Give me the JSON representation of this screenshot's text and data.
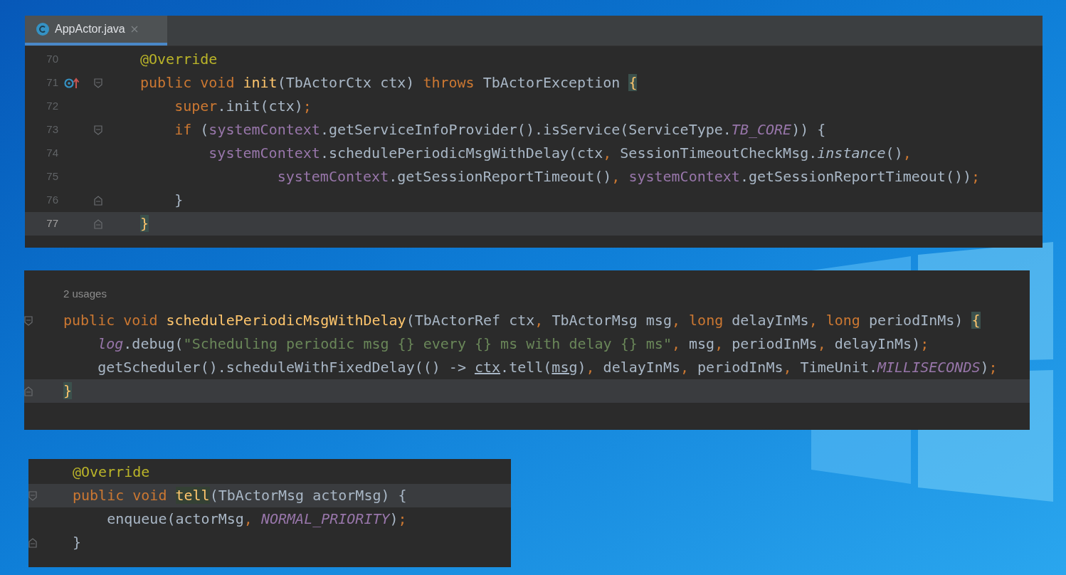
{
  "panels": [
    {
      "tab": {
        "label": "AppActor.java",
        "selected": true
      },
      "lines": [
        {
          "number": "70",
          "current": false,
          "tokens": [
            {
              "text": "@Override",
              "kind": "anno"
            }
          ]
        },
        {
          "number": "71",
          "current": false,
          "override_marker": true,
          "fold_start": true,
          "tokens": [
            {
              "text": "public void ",
              "kind": "kw"
            },
            {
              "text": "init",
              "kind": "decl"
            },
            {
              "text": "(TbActorCtx ctx) ",
              "kind": "plain"
            },
            {
              "text": "throws ",
              "kind": "kw"
            },
            {
              "text": "TbActorException ",
              "kind": "plain"
            },
            {
              "text": "{",
              "kind": "brace"
            }
          ]
        },
        {
          "number": "72",
          "current": false,
          "tokens": [
            {
              "text": "    super",
              "kind": "kw"
            },
            {
              "text": ".init(ctx)",
              "kind": "plain"
            },
            {
              "text": ";",
              "kind": "punct"
            }
          ]
        },
        {
          "number": "73",
          "current": false,
          "fold_start": true,
          "tokens": [
            {
              "text": "    if ",
              "kind": "kw"
            },
            {
              "text": "(",
              "kind": "plain"
            },
            {
              "text": "systemContext",
              "kind": "field"
            },
            {
              "text": ".getServiceInfoProvider().isService(ServiceType.",
              "kind": "plain"
            },
            {
              "text": "TB_CORE",
              "kind": "static"
            },
            {
              "text": ")) {",
              "kind": "plain"
            }
          ]
        },
        {
          "number": "74",
          "current": false,
          "tokens": [
            {
              "text": "        systemContext",
              "kind": "field"
            },
            {
              "text": ".schedulePeriodicMsgWithDelay(ctx",
              "kind": "plain"
            },
            {
              "text": ", ",
              "kind": "punct"
            },
            {
              "text": "SessionTimeoutCheckMsg.",
              "kind": "plain"
            },
            {
              "text": "instance",
              "kind": "static_method"
            },
            {
              "text": "()",
              "kind": "plain"
            },
            {
              "text": ",",
              "kind": "punct"
            }
          ]
        },
        {
          "number": "75",
          "current": false,
          "tokens": [
            {
              "text": "                systemContext",
              "kind": "field"
            },
            {
              "text": ".getSessionReportTimeout()",
              "kind": "plain"
            },
            {
              "text": ", ",
              "kind": "punct"
            },
            {
              "text": "systemContext",
              "kind": "field"
            },
            {
              "text": ".getSessionReportTimeout())",
              "kind": "plain"
            },
            {
              "text": ";",
              "kind": "punct"
            }
          ]
        },
        {
          "number": "76",
          "current": false,
          "fold_end": true,
          "tokens": [
            {
              "text": "    }",
              "kind": "plain"
            }
          ]
        },
        {
          "number": "77",
          "current": true,
          "fold_end": true,
          "tokens": [
            {
              "text": "}",
              "kind": "brace"
            }
          ]
        }
      ]
    },
    {
      "usages": "2 usages",
      "lines": [
        {
          "current": false,
          "fold_start": true,
          "tokens": [
            {
              "text": "public void ",
              "kind": "kw"
            },
            {
              "text": "schedulePeriodicMsgWithDelay",
              "kind": "decl"
            },
            {
              "text": "(TbActorRef ctx",
              "kind": "plain"
            },
            {
              "text": ", ",
              "kind": "punct"
            },
            {
              "text": "TbActorMsg msg",
              "kind": "plain"
            },
            {
              "text": ", ",
              "kind": "punct"
            },
            {
              "text": "long ",
              "kind": "kw"
            },
            {
              "text": "delayInMs",
              "kind": "plain"
            },
            {
              "text": ", ",
              "kind": "punct"
            },
            {
              "text": "long ",
              "kind": "kw"
            },
            {
              "text": "periodInMs) ",
              "kind": "plain"
            },
            {
              "text": "{",
              "kind": "brace"
            }
          ]
        },
        {
          "current": false,
          "tokens": [
            {
              "text": "    log",
              "kind": "static"
            },
            {
              "text": ".debug(",
              "kind": "plain"
            },
            {
              "text": "\"Scheduling periodic msg {} every {} ms with delay {} ms\"",
              "kind": "string"
            },
            {
              "text": ", ",
              "kind": "punct"
            },
            {
              "text": "msg",
              "kind": "plain"
            },
            {
              "text": ", ",
              "kind": "punct"
            },
            {
              "text": "periodInMs",
              "kind": "plain"
            },
            {
              "text": ", ",
              "kind": "punct"
            },
            {
              "text": "delayInMs)",
              "kind": "plain"
            },
            {
              "text": ";",
              "kind": "punct"
            }
          ]
        },
        {
          "current": false,
          "tokens": [
            {
              "text": "    getScheduler().scheduleWithFixedDelay(() -> ",
              "kind": "plain"
            },
            {
              "text": "ctx",
              "kind": "captured"
            },
            {
              "text": ".tell(",
              "kind": "plain"
            },
            {
              "text": "msg",
              "kind": "captured"
            },
            {
              "text": ")",
              "kind": "plain"
            },
            {
              "text": ", ",
              "kind": "punct"
            },
            {
              "text": "delayInMs",
              "kind": "plain"
            },
            {
              "text": ", ",
              "kind": "punct"
            },
            {
              "text": "periodInMs",
              "kind": "plain"
            },
            {
              "text": ", ",
              "kind": "punct"
            },
            {
              "text": "TimeUnit.",
              "kind": "plain"
            },
            {
              "text": "MILLISECONDS",
              "kind": "static"
            },
            {
              "text": ")",
              "kind": "plain"
            },
            {
              "text": ";",
              "kind": "punct"
            }
          ]
        },
        {
          "current": true,
          "fold_end": true,
          "tokens": [
            {
              "text": "}",
              "kind": "brace"
            }
          ]
        }
      ]
    },
    {
      "lines": [
        {
          "current": false,
          "tokens": [
            {
              "text": "@Override",
              "kind": "anno"
            }
          ]
        },
        {
          "current": true,
          "fold_start": true,
          "tokens": [
            {
              "text": "public void ",
              "kind": "kw"
            },
            {
              "text": "tell",
              "kind": "usage"
            },
            {
              "text": "(TbActorMsg actorMsg) {",
              "kind": "plain"
            }
          ]
        },
        {
          "current": false,
          "tokens": [
            {
              "text": "    enqueue(actorMsg",
              "kind": "plain"
            },
            {
              "text": ", ",
              "kind": "punct"
            },
            {
              "text": "NORMAL_PRIORITY",
              "kind": "static"
            },
            {
              "text": ")",
              "kind": "plain"
            },
            {
              "text": ";",
              "kind": "punct"
            }
          ]
        },
        {
          "current": false,
          "fold_end": true,
          "tokens": [
            {
              "text": "}",
              "kind": "plain"
            }
          ]
        }
      ]
    }
  ]
}
